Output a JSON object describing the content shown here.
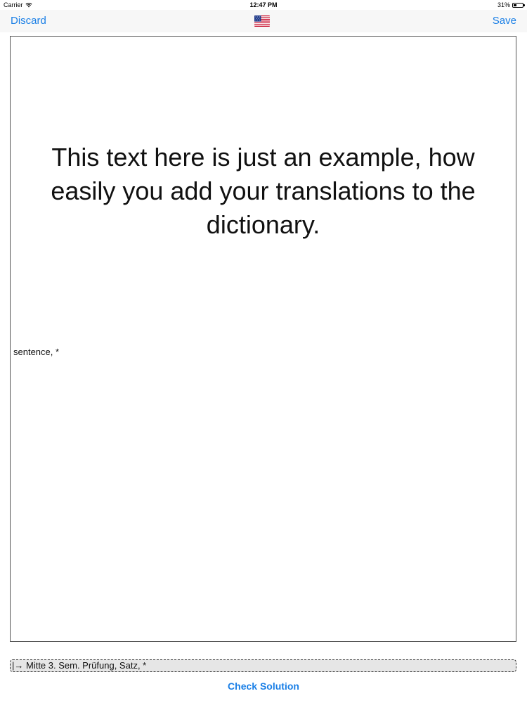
{
  "status_bar": {
    "carrier": "Carrier",
    "time": "12:47 PM",
    "battery_percent_label": "31%",
    "battery_level": 0.31,
    "wifi_icon": "wifi-icon",
    "battery_icon": "battery-icon"
  },
  "nav": {
    "discard_label": "Discard",
    "save_label": "Save",
    "flag_icon": "us-flag-icon"
  },
  "card": {
    "text": "This text here is just an example, how easily you add your translations to the dictionary.",
    "tags": "sentence, *"
  },
  "tag_bar": {
    "text": "|→ Mitte 3. Sem. Prüfung, Satz, *"
  },
  "actions": {
    "check_label": "Check Solution"
  },
  "colors": {
    "accent": "#1a7fe6",
    "nav_background": "#f7f7f7",
    "tag_bar_background": "#e6e6e6"
  }
}
